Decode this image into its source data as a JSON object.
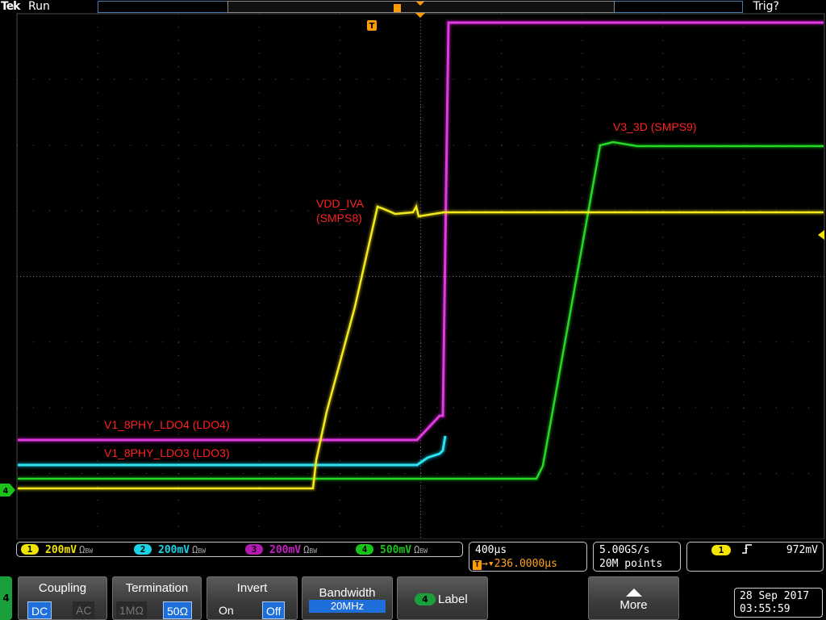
{
  "header": {
    "brand": "Tek",
    "run_state": "Run",
    "trigger_state": "Trig?"
  },
  "markers": {
    "trigger_position": "T",
    "channel4_ground": "4",
    "menu_channel": "4"
  },
  "colors": {
    "ch1": "#f0e400",
    "ch2": "#19d4e6",
    "ch3": "#d21ed2",
    "ch4": "#19c419",
    "label": "#ff2020",
    "accent_blue": "#1e6fd9",
    "trigger_orange": "#ff9a00"
  },
  "trace_labels": [
    {
      "id": "vdd-iva",
      "text": "VDD_IVA"
    },
    {
      "id": "vdd-iva-source",
      "text": "(SMPS8)"
    },
    {
      "id": "v3-3d",
      "text": "V3_3D (SMPS9)"
    },
    {
      "id": "v1-8phy-ldo4",
      "text": "V1_8PHY_LDO4 (LDO4)"
    },
    {
      "id": "v1-8phy-ldo3",
      "text": "V1_8PHY_LDO3 (LDO3)"
    }
  ],
  "channels": [
    {
      "num": "1",
      "scale": "200mV",
      "term": "Ω",
      "bw": "BW",
      "color": "#f0e400"
    },
    {
      "num": "2",
      "scale": "200mV",
      "term": "Ω",
      "bw": "BW",
      "color": "#19d4e6"
    },
    {
      "num": "3",
      "scale": "200mV",
      "term": "Ω",
      "bw": "BW",
      "color": "#d21ed2"
    },
    {
      "num": "4",
      "scale": "500mV",
      "term": "Ω",
      "bw": "BW",
      "color": "#19c419"
    }
  ],
  "horizontal": {
    "scale": "400µs",
    "delay": "236.0000µs"
  },
  "acquisition": {
    "sample_rate": "5.00GS/s",
    "record_length": "20M points"
  },
  "trigger": {
    "source": "1",
    "slope_icon": "rising-edge-icon",
    "level": "972mV"
  },
  "menu": {
    "coupling": {
      "title": "Coupling",
      "options": [
        "DC",
        "AC"
      ],
      "selected": "DC"
    },
    "termination": {
      "title": "Termination",
      "options": [
        "1MΩ",
        "50Ω"
      ],
      "selected": "50Ω"
    },
    "invert": {
      "title": "Invert",
      "options": [
        "On",
        "Off"
      ],
      "selected": "Off"
    },
    "bandwidth": {
      "title": "Bandwidth",
      "value": "20MHz"
    },
    "label": {
      "title": "Label",
      "channel": "4"
    },
    "more": {
      "title": "More"
    }
  },
  "datetime": {
    "date": "28 Sep 2017",
    "time": "03:55:59"
  }
}
